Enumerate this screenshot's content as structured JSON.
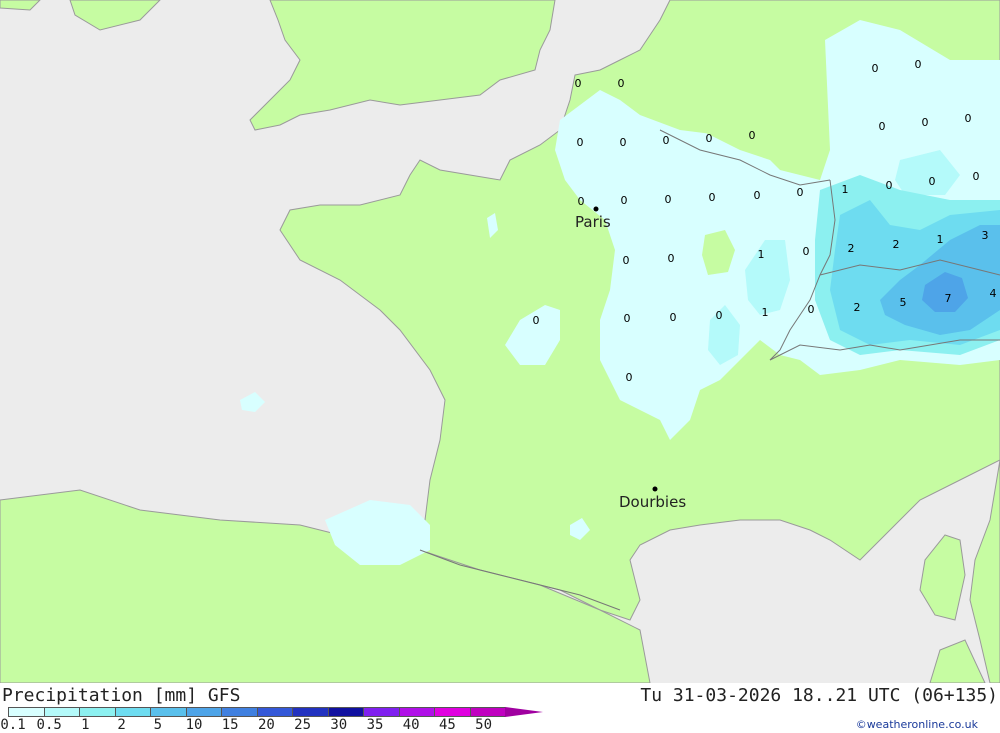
{
  "map": {
    "cities": [
      {
        "name": "Paris"
      },
      {
        "name": "Dourbies"
      }
    ],
    "grid_values": [
      "0",
      "0",
      "0",
      "0",
      "0",
      "0",
      "0",
      "0",
      "0",
      "0",
      "0",
      "0",
      "0",
      "0",
      "0",
      "0",
      "0",
      "0",
      "1",
      "0",
      "0",
      "0",
      "2",
      "2",
      "1",
      "3",
      "0",
      "0",
      "0",
      "1",
      "1",
      "0",
      "2",
      "5",
      "7",
      "4",
      "0",
      "0",
      "0",
      "0",
      "0"
    ]
  },
  "legend": {
    "title": "Precipitation [mm] GFS",
    "colors": [
      "#d8ffff",
      "#b4fafa",
      "#8cf0f0",
      "#6edcf0",
      "#5ac0ec",
      "#4ea4e8",
      "#4080e0",
      "#3458d8",
      "#2232c0",
      "#1010a0",
      "#8020f0",
      "#b010e8",
      "#e000e0",
      "#c000c0"
    ],
    "ticks": [
      "0.1",
      "0.5",
      "1",
      "2",
      "5",
      "10",
      "15",
      "20",
      "25",
      "30",
      "35",
      "40",
      "45",
      "50"
    ]
  },
  "valid_time": "Tu 31-03-2026 18..21 UTC (06+135)",
  "credit": "©weatheronline.co.uk"
}
